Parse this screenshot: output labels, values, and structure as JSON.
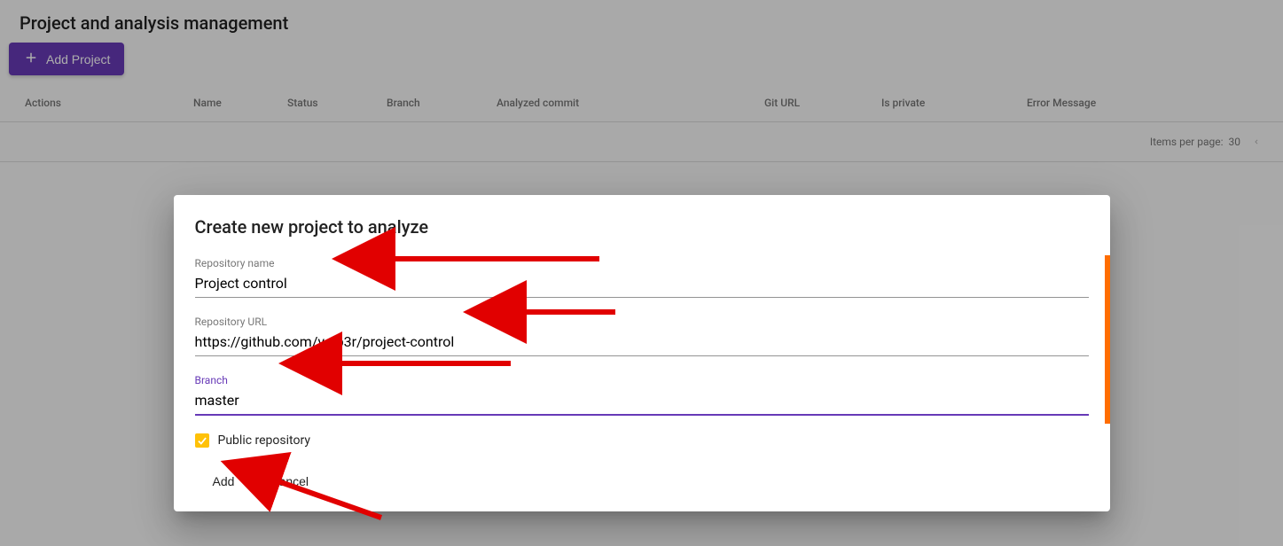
{
  "page": {
    "title": "Project and analysis management",
    "add_button": "Add Project"
  },
  "table": {
    "headers": {
      "actions": "Actions",
      "name": "Name",
      "status": "Status",
      "branch": "Branch",
      "analyzed_commit": "Analyzed commit",
      "git_url": "Git URL",
      "is_private": "Is private",
      "error_message": "Error Message"
    },
    "paginator": {
      "label": "Items per page:",
      "value": "30"
    }
  },
  "dialog": {
    "title": "Create new project to analyze",
    "fields": {
      "repo_name": {
        "label": "Repository name",
        "value": "Project control"
      },
      "repo_url": {
        "label": "Repository URL",
        "value": "https://github.com/valb3r/project-control"
      },
      "branch": {
        "label": "Branch",
        "value": "master"
      }
    },
    "checkbox": {
      "label": "Public repository",
      "checked": true
    },
    "actions": {
      "add": "Add",
      "cancel": "Cancel"
    }
  }
}
